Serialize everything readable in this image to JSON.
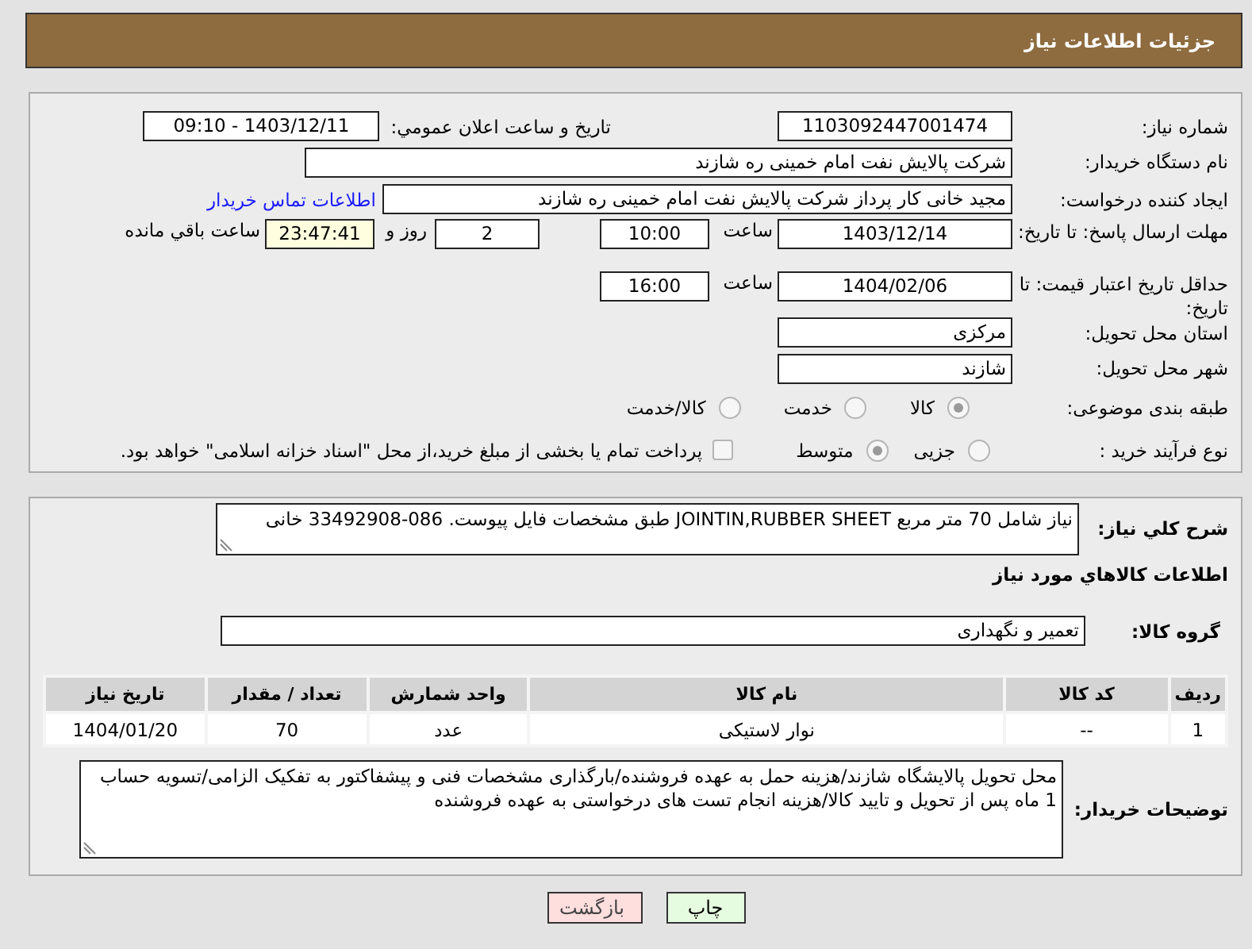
{
  "header": {
    "title": "جزئیات اطلاعات نیاز"
  },
  "need_number": {
    "label": "شماره نیاز:",
    "value": "1103092447001474"
  },
  "announce": {
    "label": "تاریخ و ساعت اعلان عمومي:",
    "value": "1403/12/11 - 09:10"
  },
  "buyer_org": {
    "label": "نام دستگاه خریدار:",
    "value": "شرکت پالایش نفت امام خمینی  ره  شازند"
  },
  "requester": {
    "label": "ایجاد کننده درخواست:",
    "value": "مجید خانی کار پرداز شرکت پالایش نفت امام خمینی  ره  شازند",
    "link": "اطلاعات تماس خریدار"
  },
  "reply_deadline": {
    "label": "مهلت ارسال پاسخ: تا تاریخ:",
    "date": "1403/12/14",
    "time_label": "ساعت",
    "time": "10:00",
    "days": "2",
    "days_label": "روز و",
    "remaining": "23:47:41",
    "remaining_label": "ساعت باقي مانده"
  },
  "price_validity": {
    "label": "حداقل تاریخ اعتبار قیمت: تا تاریخ:",
    "date": "1404/02/06",
    "time_label": "ساعت",
    "time": "16:00"
  },
  "province": {
    "label": "استان محل تحویل:",
    "value": "مرکزی"
  },
  "city": {
    "label": "شهر محل تحویل:",
    "value": "شازند"
  },
  "category": {
    "label": "طبقه بندی موضوعی:",
    "options": [
      {
        "label": "کالا",
        "selected": true
      },
      {
        "label": "خدمت",
        "selected": false
      },
      {
        "label": "کالا/خدمت",
        "selected": false
      }
    ]
  },
  "purchase_type": {
    "label": "نوع فرآیند خرید :",
    "options": [
      {
        "label": "جزیی",
        "selected": false
      },
      {
        "label": "متوسط",
        "selected": true
      }
    ],
    "treasury": {
      "label": "پرداخت تمام یا بخشی از مبلغ خرید،از محل \"اسناد خزانه اسلامی\" خواهد بود.",
      "checked": false
    }
  },
  "description": {
    "label": "شرح کلي نياز:",
    "value": "نیاز شامل 70 متر مربع JOINTIN,RUBBER SHEET  طبق مشخصات فایل پیوست. 086-33492908 خانی"
  },
  "goods_section": {
    "title": "اطلاعات کالاهاي مورد نياز"
  },
  "goods_group": {
    "label": "گروه کالا:",
    "value": "تعمیر و نگهداری"
  },
  "table": {
    "columns": [
      "ردیف",
      "کد کالا",
      "نام کالا",
      "واحد شمارش",
      "تعداد / مقدار",
      "تاریخ نیاز"
    ],
    "rows": [
      [
        "1",
        "--",
        "نوار لاستیکی",
        "عدد",
        "70",
        "1404/01/20"
      ]
    ]
  },
  "buyer_notes": {
    "label": "توضیحات خریدار:",
    "value": "محل تحویل پالایشگاه شازند/هزینه حمل به عهده فروشنده/بارگذاری مشخصات فنی و پیشفاکتور به تفکیک الزامی/تسویه حساب 1 ماه پس از تحویل و تایید کالا/هزینه انجام تست های درخواستی به عهده فروشنده"
  },
  "buttons": [
    {
      "label": "چاپ",
      "kind": "print"
    },
    {
      "label": "بازگشت",
      "kind": "back"
    }
  ]
}
